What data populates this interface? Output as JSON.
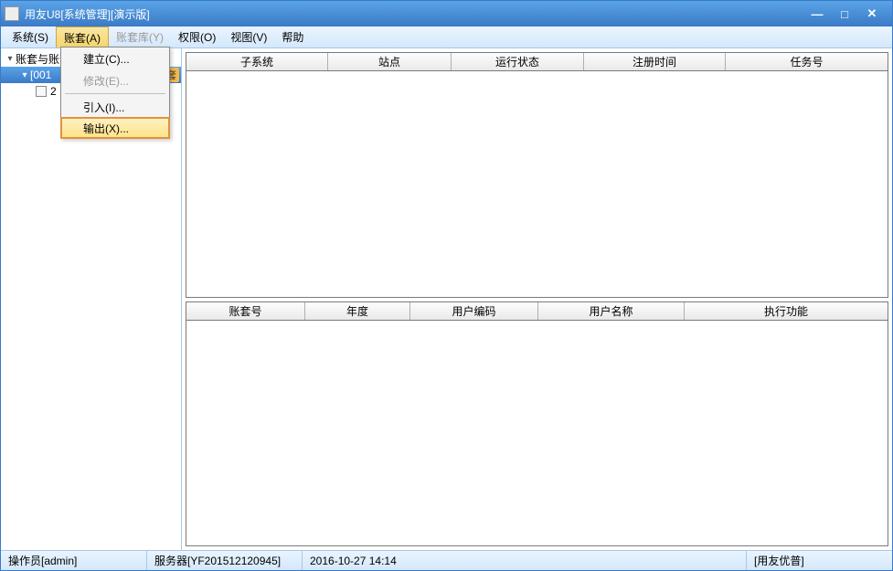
{
  "title": "用友U8[系统管理][演示版]",
  "menubar": {
    "system": "系统(S)",
    "account": "账套(A)",
    "account_lib": "账套库(Y)",
    "permission": "权限(O)",
    "view": "视图(V)",
    "help": "帮助"
  },
  "dropdown": {
    "create": "建立(C)...",
    "modify": "修改(E)...",
    "import": "引入(I)...",
    "export": "输出(X)..."
  },
  "tree": {
    "root": "账套与账套库",
    "node1": "[001",
    "node1_badge": "套",
    "node2": "2"
  },
  "grid1": {
    "cols": [
      "子系统",
      "站点",
      "运行状态",
      "注册时间",
      "任务号"
    ]
  },
  "grid2": {
    "cols": [
      "账套号",
      "年度",
      "用户编码",
      "用户名称",
      "执行功能"
    ]
  },
  "status": {
    "operator": "操作员[admin]",
    "server": "服务器[YF201512120945]",
    "datetime": "2016-10-27 14:14",
    "company": "[用友优普]"
  }
}
